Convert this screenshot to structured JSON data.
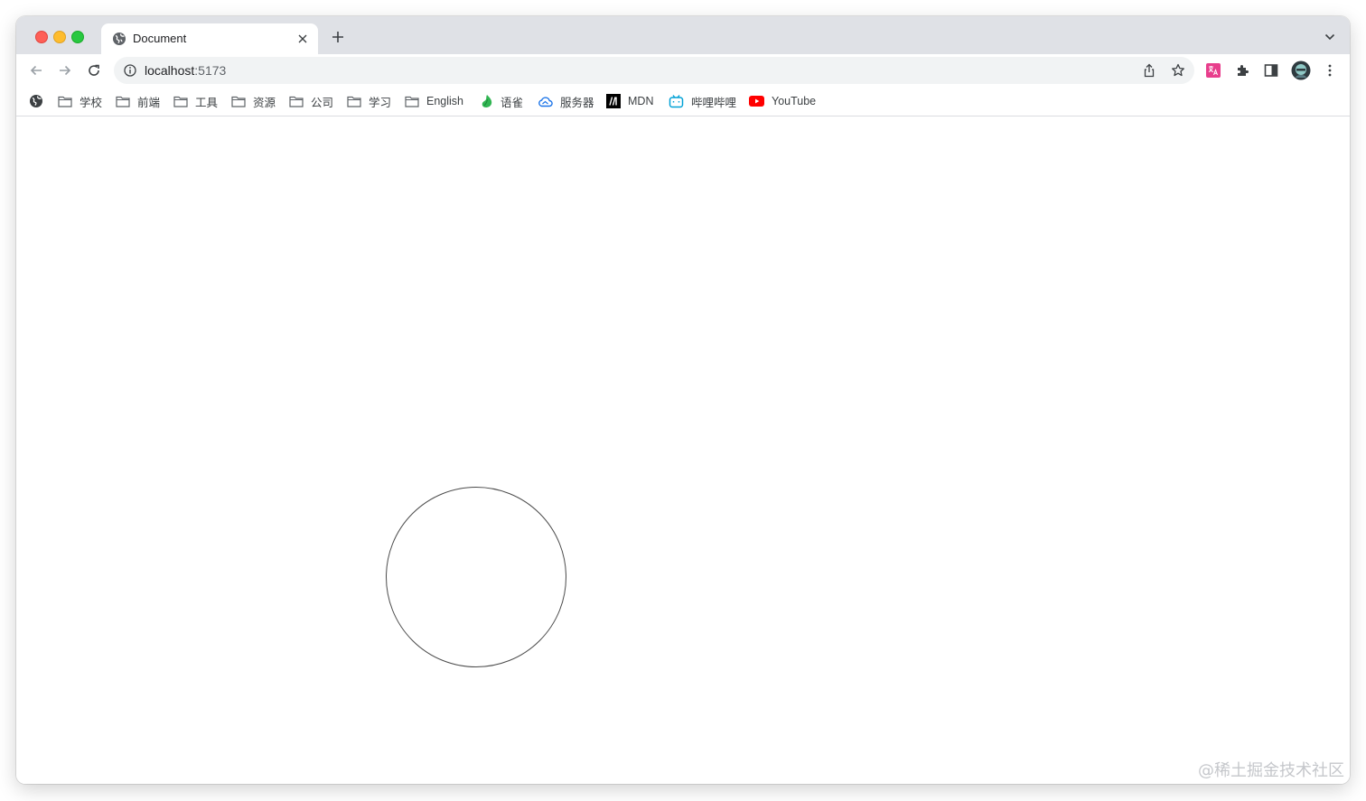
{
  "tab": {
    "title": "Document",
    "favicon": "globe-icon"
  },
  "toolbar": {
    "url_host": "localhost",
    "url_port": ":5173"
  },
  "bookmarks": [
    {
      "label": "学校",
      "icon": "folder-icon"
    },
    {
      "label": "前端",
      "icon": "folder-icon"
    },
    {
      "label": "工具",
      "icon": "folder-icon"
    },
    {
      "label": "资源",
      "icon": "folder-icon"
    },
    {
      "label": "公司",
      "icon": "folder-icon"
    },
    {
      "label": "学习",
      "icon": "folder-icon"
    },
    {
      "label": "English",
      "icon": "folder-icon"
    },
    {
      "label": "语雀",
      "icon": "yuque-icon"
    },
    {
      "label": "服务器",
      "icon": "cloud-icon"
    },
    {
      "label": "MDN",
      "icon": "mdn-icon"
    },
    {
      "label": "哔哩哔哩",
      "icon": "bilibili-icon"
    },
    {
      "label": "YouTube",
      "icon": "youtube-icon"
    }
  ],
  "watermark": "@稀土掘金技术社区",
  "colors": {
    "tabstrip": "#dfe1e6",
    "omnibox": "#f1f3f4",
    "circle_stroke": "#4a4a4a"
  }
}
